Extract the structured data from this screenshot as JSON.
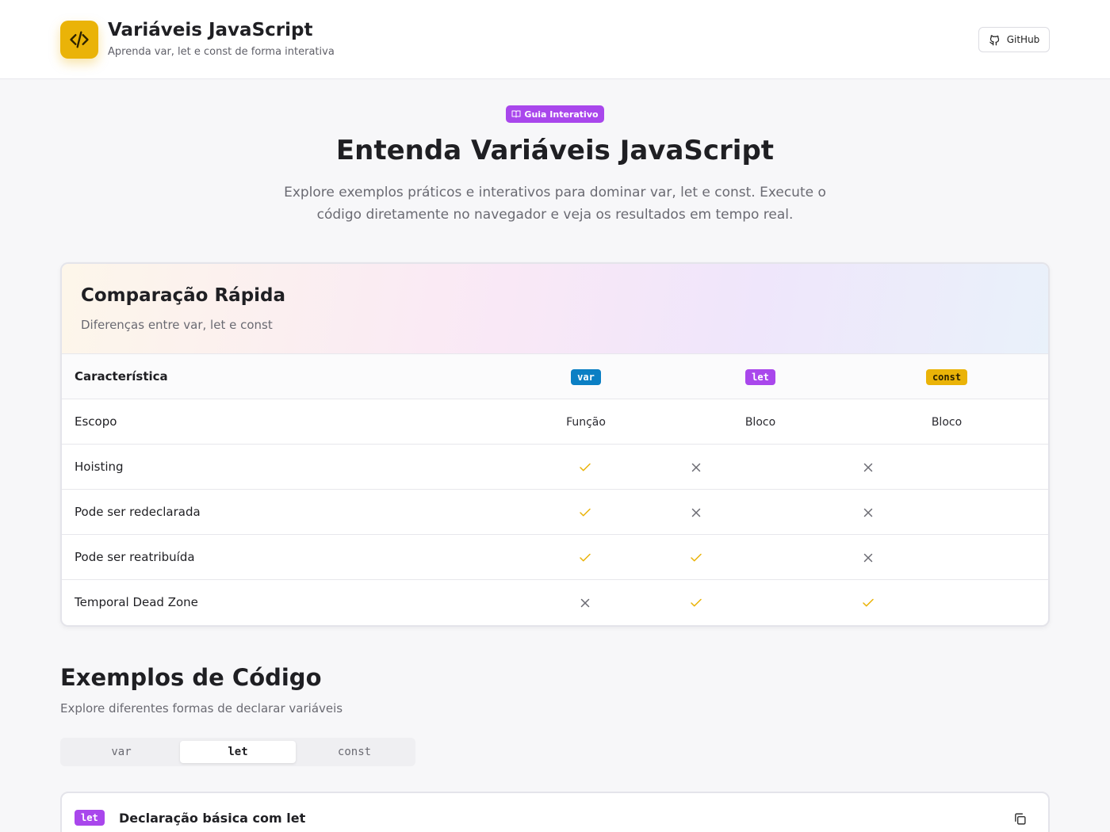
{
  "header": {
    "title": "Variáveis JavaScript",
    "subtitle": "Aprenda var, let e const de forma interativa",
    "logo_icon": "code-icon",
    "github_label": "GitHub",
    "github_icon": "github-icon"
  },
  "hero": {
    "pill_label": "Guia Interativo",
    "pill_icon": "book-icon",
    "title": "Entenda Variáveis JavaScript",
    "description": "Explore exemplos práticos e interativos para dominar var, let e const. Execute o código diretamente no navegador e veja os resultados em tempo real."
  },
  "comparison": {
    "title": "Comparação Rápida",
    "description": "Diferenças entre var, let e const",
    "header_label": "Característica",
    "columns": [
      "var",
      "let",
      "const"
    ],
    "rows": [
      {
        "label": "Escopo",
        "values": [
          "Função",
          "Bloco",
          "Bloco"
        ]
      },
      {
        "label": "Hoisting",
        "values": [
          "check",
          "x",
          "x"
        ]
      },
      {
        "label": "Pode ser redeclarada",
        "values": [
          "check",
          "x",
          "x"
        ]
      },
      {
        "label": "Pode ser reatribuída",
        "values": [
          "check",
          "check",
          "x"
        ]
      },
      {
        "label": "Temporal Dead Zone",
        "values": [
          "x",
          "check",
          "check"
        ]
      }
    ]
  },
  "examples": {
    "title": "Exemplos de Código",
    "description": "Explore diferentes formas de declarar variáveis",
    "tabs": [
      "var",
      "let",
      "const"
    ],
    "active_tab": "let",
    "card": {
      "badge": "let",
      "title": "Declaração básica com let",
      "copy_icon": "copy-icon"
    }
  },
  "colors": {
    "accent_yellow": "#eab308",
    "accent_purple": "#a947ec",
    "accent_blue": "#0b7fc4"
  }
}
